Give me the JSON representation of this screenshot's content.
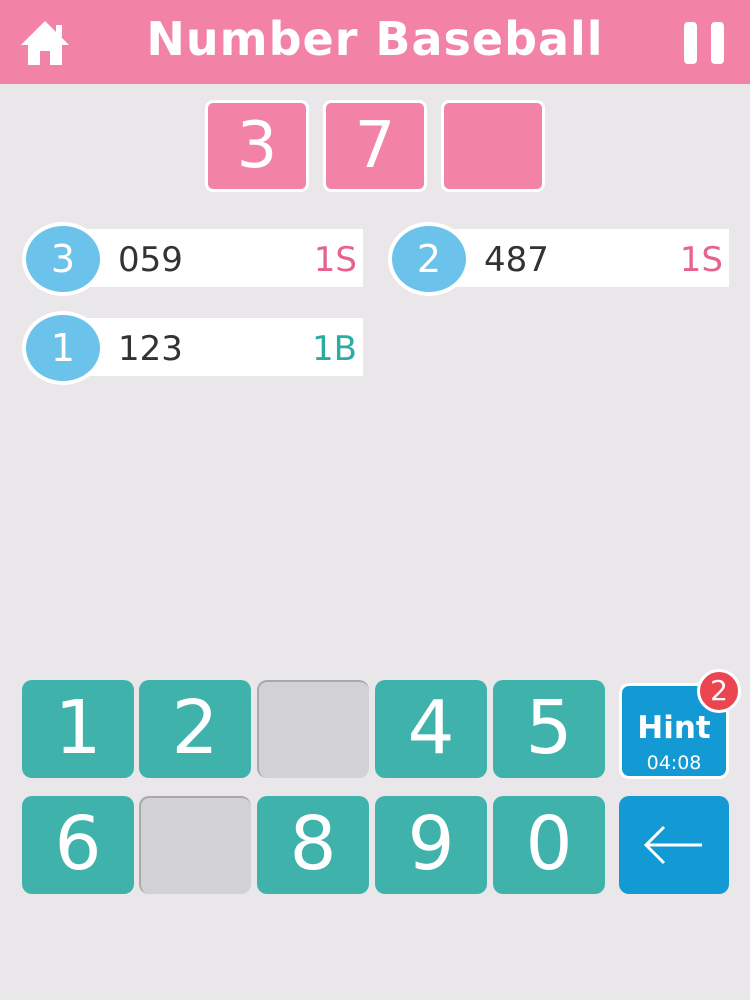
{
  "header": {
    "title": "Number Baseball",
    "home_icon": "home-icon",
    "pause_icon": "pause-icon",
    "color": "#f283a6"
  },
  "answer_slots": [
    "3",
    "7",
    ""
  ],
  "history": [
    {
      "attempt": "3",
      "guess": "059",
      "result": "1S",
      "result_type": "strike"
    },
    {
      "attempt": "2",
      "guess": "487",
      "result": "1S",
      "result_type": "strike"
    },
    {
      "attempt": "1",
      "guess": "123",
      "result": "1B",
      "result_type": "ball"
    }
  ],
  "keypad": {
    "row1": [
      {
        "label": "1",
        "used": false
      },
      {
        "label": "2",
        "used": false
      },
      {
        "label": "",
        "used": true
      },
      {
        "label": "4",
        "used": false
      },
      {
        "label": "5",
        "used": false
      }
    ],
    "row2": [
      {
        "label": "6",
        "used": false
      },
      {
        "label": "",
        "used": true
      },
      {
        "label": "8",
        "used": false
      },
      {
        "label": "9",
        "used": false
      },
      {
        "label": "0",
        "used": false
      }
    ],
    "key_color": "#3fb2ac",
    "used_color": "#d2d2d4"
  },
  "hint": {
    "label": "Hint",
    "timer": "04:08",
    "badge_count": "2",
    "color": "#139ad5"
  },
  "backspace": {
    "icon": "back-arrow-icon",
    "color": "#139ad5"
  }
}
